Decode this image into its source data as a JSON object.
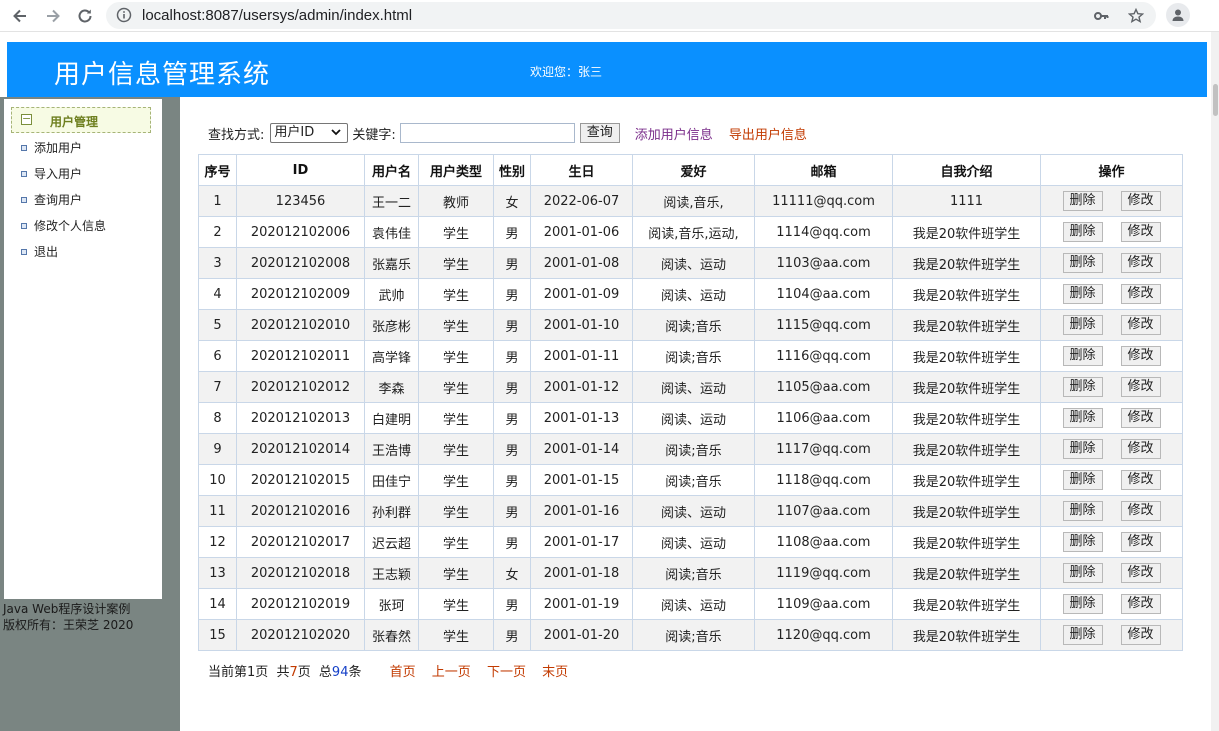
{
  "browser": {
    "url": "localhost:8087/usersys/admin/index.html"
  },
  "header": {
    "title": "用户信息管理系统",
    "welcome": "欢迎您：张三"
  },
  "sidebar": {
    "group_label": "用户管理",
    "items": [
      {
        "label": "添加用户"
      },
      {
        "label": "导入用户"
      },
      {
        "label": "查询用户"
      },
      {
        "label": "修改个人信息"
      },
      {
        "label": "退出"
      }
    ],
    "footer_line1": "Java Web程序设计案例",
    "footer_line2": "版权所有：王荣芝 2020"
  },
  "search": {
    "mode_label": "查找方式:",
    "mode_value": "用户ID",
    "keyword_label": "关键字:",
    "keyword_value": "",
    "query_button": "查询",
    "add_link": "添加用户信息",
    "export_link": "导出用户信息"
  },
  "table": {
    "headers": [
      "序号",
      "ID",
      "用户名",
      "用户类型",
      "性别",
      "生日",
      "爱好",
      "邮箱",
      "自我介绍",
      "操作"
    ],
    "delete_label": "删除",
    "edit_label": "修改",
    "rows": [
      [
        "1",
        "123456",
        "王一二",
        "教师",
        "女",
        "2022-06-07",
        "阅读,音乐,",
        "11111@qq.com",
        "1111"
      ],
      [
        "2",
        "202012102006",
        "袁伟佳",
        "学生",
        "男",
        "2001-01-06",
        "阅读,音乐,运动,",
        "1114@qq.com",
        "我是20软件班学生"
      ],
      [
        "3",
        "202012102008",
        "张嘉乐",
        "学生",
        "男",
        "2001-01-08",
        "阅读、运动",
        "1103@aa.com",
        "我是20软件班学生"
      ],
      [
        "4",
        "202012102009",
        "武帅",
        "学生",
        "男",
        "2001-01-09",
        "阅读、运动",
        "1104@aa.com",
        "我是20软件班学生"
      ],
      [
        "5",
        "202012102010",
        "张彦彬",
        "学生",
        "男",
        "2001-01-10",
        "阅读;音乐",
        "1115@qq.com",
        "我是20软件班学生"
      ],
      [
        "6",
        "202012102011",
        "高学锋",
        "学生",
        "男",
        "2001-01-11",
        "阅读;音乐",
        "1116@qq.com",
        "我是20软件班学生"
      ],
      [
        "7",
        "202012102012",
        "李森",
        "学生",
        "男",
        "2001-01-12",
        "阅读、运动",
        "1105@aa.com",
        "我是20软件班学生"
      ],
      [
        "8",
        "202012102013",
        "白建明",
        "学生",
        "男",
        "2001-01-13",
        "阅读、运动",
        "1106@aa.com",
        "我是20软件班学生"
      ],
      [
        "9",
        "202012102014",
        "王浩博",
        "学生",
        "男",
        "2001-01-14",
        "阅读;音乐",
        "1117@qq.com",
        "我是20软件班学生"
      ],
      [
        "10",
        "202012102015",
        "田佳宁",
        "学生",
        "男",
        "2001-01-15",
        "阅读;音乐",
        "1118@qq.com",
        "我是20软件班学生"
      ],
      [
        "11",
        "202012102016",
        "孙利群",
        "学生",
        "男",
        "2001-01-16",
        "阅读、运动",
        "1107@aa.com",
        "我是20软件班学生"
      ],
      [
        "12",
        "202012102017",
        "迟云超",
        "学生",
        "男",
        "2001-01-17",
        "阅读、运动",
        "1108@aa.com",
        "我是20软件班学生"
      ],
      [
        "13",
        "202012102018",
        "王志颖",
        "学生",
        "女",
        "2001-01-18",
        "阅读;音乐",
        "1119@qq.com",
        "我是20软件班学生"
      ],
      [
        "14",
        "202012102019",
        "张珂",
        "学生",
        "男",
        "2001-01-19",
        "阅读、运动",
        "1109@aa.com",
        "我是20软件班学生"
      ],
      [
        "15",
        "202012102020",
        "张春然",
        "学生",
        "男",
        "2001-01-20",
        "阅读;音乐",
        "1120@qq.com",
        "我是20软件班学生"
      ]
    ]
  },
  "pager": {
    "current_prefix": "当前第",
    "current_page": "1",
    "current_suffix": "页",
    "total_prefix": "共",
    "total_pages": "7",
    "total_suffix": "页",
    "count_prefix": "总",
    "total_count": "94",
    "count_suffix": "条",
    "first": "首页",
    "prev": "上一页",
    "next": "下一页",
    "last": "末页"
  },
  "colors": {
    "header_bg": "#0a90ff",
    "sidebar_bg": "#7a8582",
    "link_export": "#c23a00",
    "link_add": "#7a2c8a"
  },
  "icons": [
    "back-arrow-icon",
    "forward-arrow-icon",
    "reload-icon",
    "info-icon",
    "key-icon",
    "star-icon",
    "profile-icon",
    "collapse-icon",
    "bullet-icon"
  ]
}
